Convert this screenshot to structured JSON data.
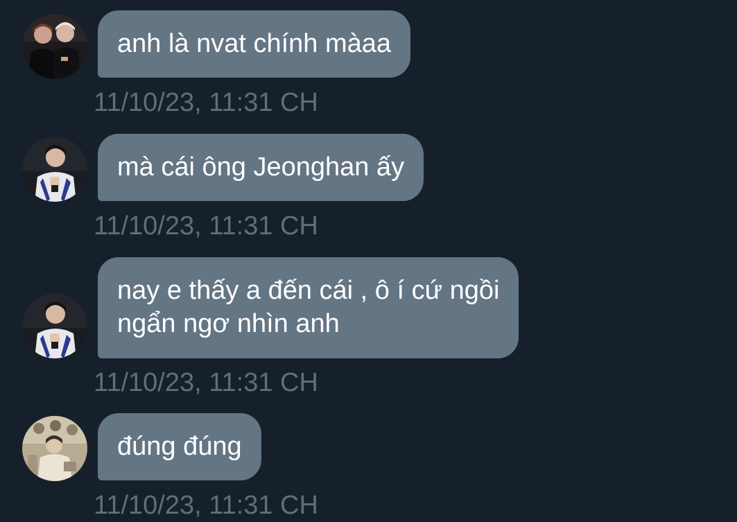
{
  "messages": [
    {
      "avatar": "profile-photo-two-people",
      "lines": [
        "anh là nvat chính màaa"
      ],
      "timestamp": "11/10/23, 11:31 CH"
    },
    {
      "avatar": "profile-photo-man-peace-sign",
      "lines": [
        "mà cái ông Jeonghan ấy"
      ],
      "timestamp": "11/10/23, 11:31 CH"
    },
    {
      "avatar": "profile-photo-man-peace-sign",
      "lines": [
        "nay e thấy a đến cái , ô í cứ ngồi",
        "ngẩn ngơ nhìn anh"
      ],
      "timestamp": "11/10/23, 11:31 CH"
    },
    {
      "avatar": "profile-photo-group-sepia",
      "lines": [
        "đúng đúng"
      ],
      "timestamp": "11/10/23, 11:31 CH"
    }
  ],
  "colors": {
    "background": "#16202a",
    "bubble": "#647584",
    "bubble_text": "#ffffff",
    "timestamp": "#5f6e7b"
  }
}
